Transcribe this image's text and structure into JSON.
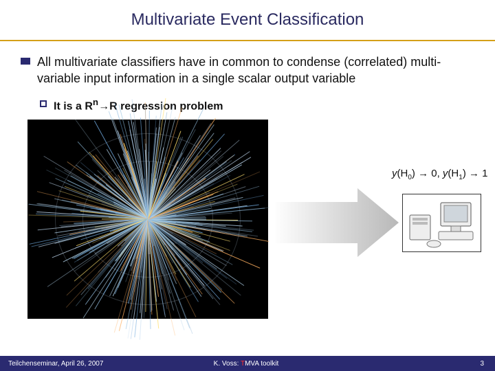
{
  "title": "Multivariate Event Classification",
  "bullet1": "All multivariate classifiers have in common to condense (correlated) multi-variable input information in a single scalar output variable",
  "bullet2_pre": "It is a R",
  "bullet2_sup": "n",
  "bullet2_arrow": "→",
  "bullet2_post": "R regression problem",
  "formula": {
    "y": "y",
    "h0": "H",
    "h0sub": "0",
    "to0": ") → 0, ",
    "h1": "H",
    "h1sub": "1",
    "to1": ") → 1"
  },
  "footer": {
    "left": "Teilchenseminar, April 26, 2007",
    "center_author": "K. Voss: ",
    "center_red": "T",
    "center_rest": "MVA toolkit",
    "page": "3"
  }
}
